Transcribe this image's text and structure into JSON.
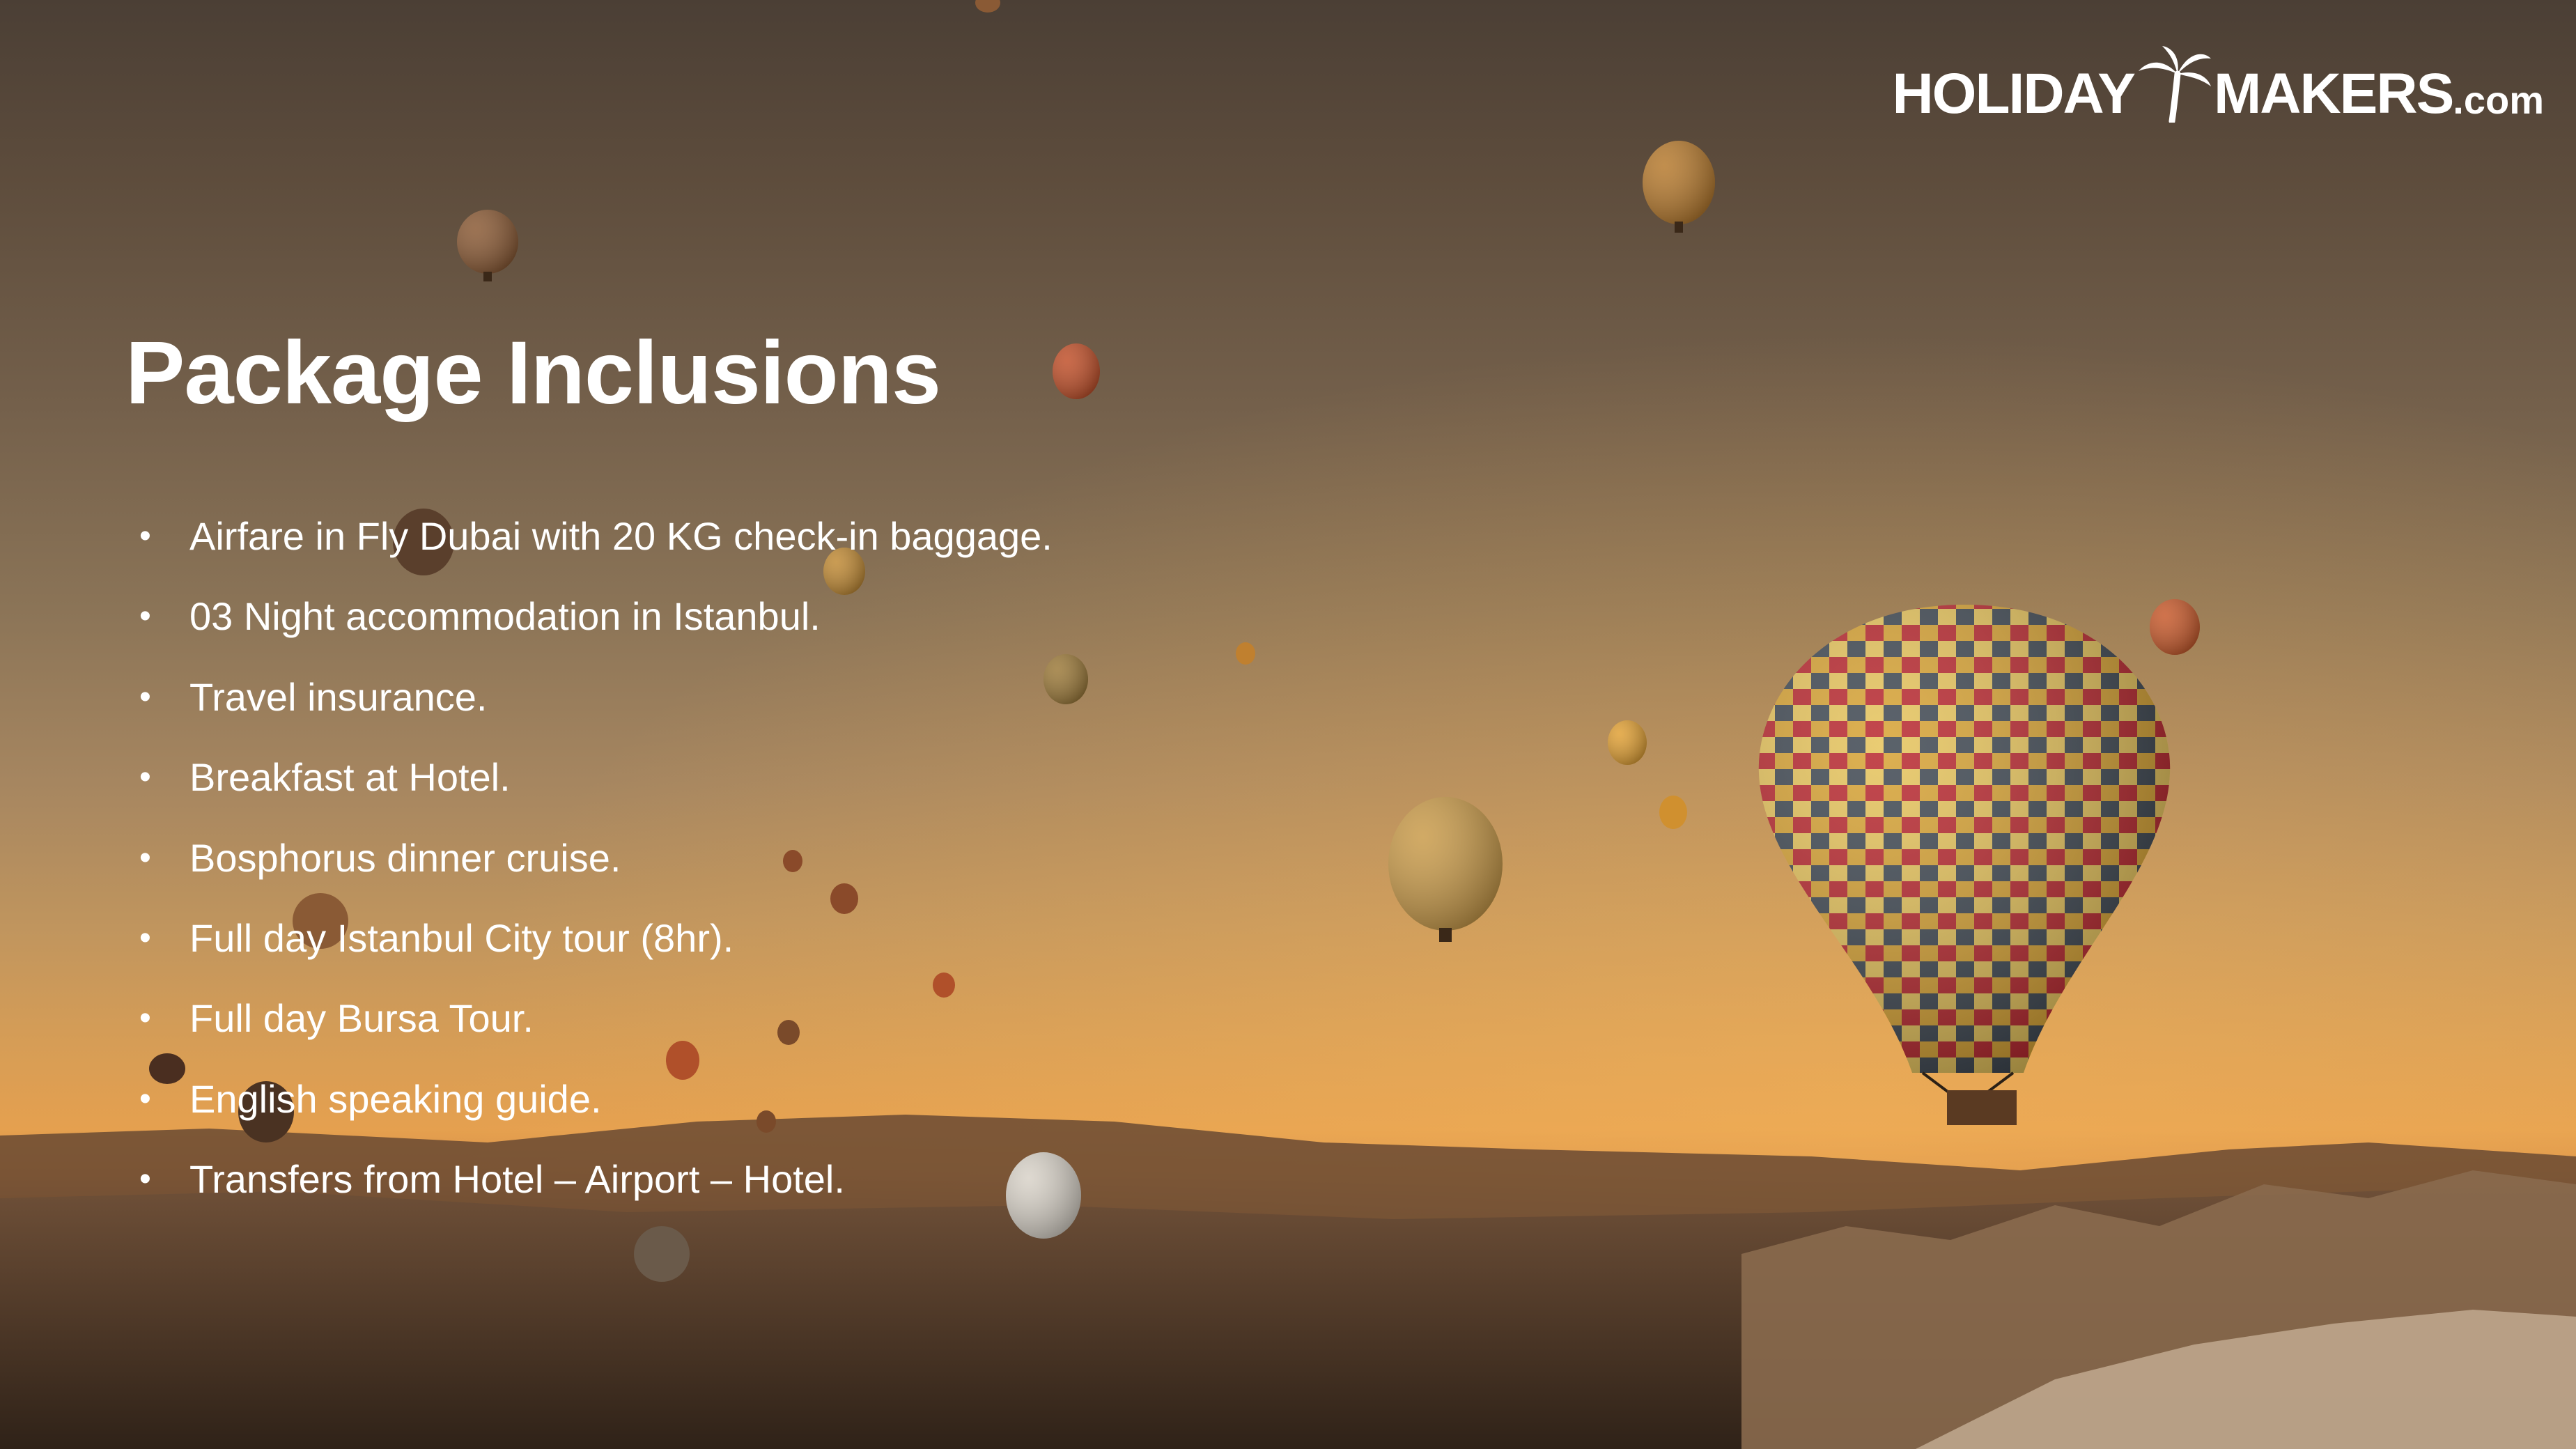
{
  "brand": {
    "logo_left": "HOLIDAY",
    "logo_right": "MAKERS",
    "logo_suffix": ".com",
    "logo_icon": "palm-tree-icon",
    "text_color": "#ffffff"
  },
  "slide": {
    "title": "Package Inclusions",
    "background": "hot air balloons over valley at sunset",
    "accent_colors": {
      "sky_top": "#4b3f35",
      "sky_glow": "#e5a04f",
      "ground": "#3a2b1f"
    },
    "inclusions": [
      "Airfare in Fly Dubai with 20 KG check-in baggage.",
      "03 Night accommodation in Istanbul.",
      "Travel insurance.",
      "Breakfast at Hotel.",
      "Bosphorus dinner cruise.",
      "Full day Istanbul City tour (8hr).",
      "Full day Bursa Tour.",
      "English speaking guide.",
      "Transfers from Hotel – Airport – Hotel."
    ]
  }
}
